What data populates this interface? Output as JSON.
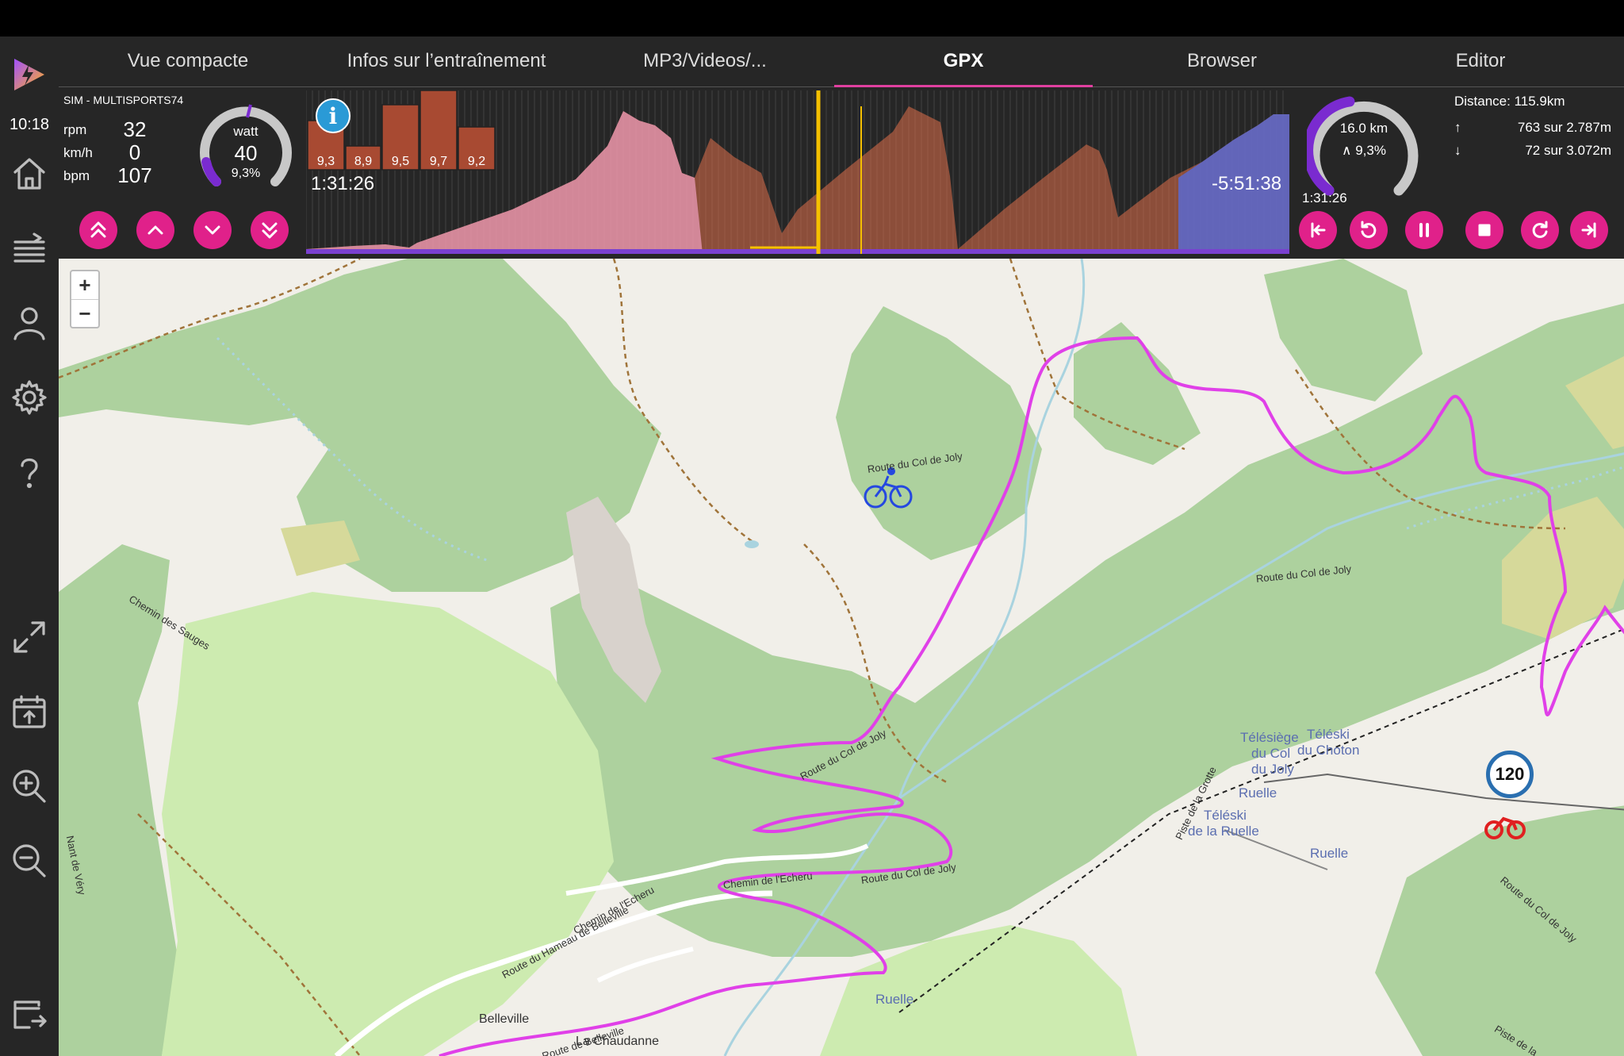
{
  "app": {
    "clock": "10:18"
  },
  "tabs": [
    {
      "label": "Vue compacte"
    },
    {
      "label": "Infos sur l’entraînement"
    },
    {
      "label": "MP3/Videos/..."
    },
    {
      "label": "GPX"
    },
    {
      "label": "Browser"
    },
    {
      "label": "Editor"
    }
  ],
  "active_tab": "GPX",
  "device": {
    "name": "SIM - MULTISPORTS74"
  },
  "metrics": {
    "rpm": {
      "unit": "rpm",
      "value": "32"
    },
    "kmh": {
      "unit": "km/h",
      "value": "0"
    },
    "bpm": {
      "unit": "bpm",
      "value": "107"
    }
  },
  "power_gauge": {
    "unit": "watt",
    "value": "40",
    "grade": "9,3%"
  },
  "profile": {
    "elapsed": "1:31:26",
    "remaining": "-5:51:38",
    "info_icon": "info-icon",
    "segment_grades": [
      "9,3",
      "8,9",
      "9,5",
      "9,7",
      "9,2"
    ]
  },
  "distance_ring": {
    "distance": "16.0 km",
    "grade": "∧ 9,3%",
    "time": "1:31:26"
  },
  "stats": {
    "total_distance": "Distance: 115.9km",
    "ascent": "763 sur 2.787m",
    "descent": "72 sur 3.072m"
  },
  "map": {
    "zoom_in": "+",
    "zoom_out": "−",
    "labels": {
      "telesiege": "Télésiège",
      "du_col": "du Col",
      "du_joly": "du Joly",
      "teleski1": "Téléski",
      "du_choton": "du Choton",
      "ruelle1": "Ruelle",
      "teleski2": "Téléski",
      "de_la_ruelle": "de la Ruelle",
      "ruelle2": "Ruelle",
      "ruelle3": "Ruelle",
      "belleville": "Belleville",
      "la_chaudanne": "La Chaudanne"
    },
    "roads": {
      "col_joly_1": "Route du Col de Joly",
      "col_joly_2": "Route du Col de Joly",
      "col_joly_3": "Route du Col de Joly",
      "col_joly_4": "Route du Col de Joly",
      "col_joly_5": "Route du Col de Joly",
      "echeru_1": "Chemin de l'Echeru",
      "echeru_2": "Chemin de l'Echeru",
      "hameau": "Route du Hameau de Belleville",
      "belleville_road": "Route de Belleville",
      "sauges": "Chemin des Sauges",
      "grotte": "Piste de la Grotte",
      "nant": "Nant de Véry",
      "piste_la": "Piste de la"
    },
    "speed_limit": "120"
  },
  "colors": {
    "accent": "#e0218a",
    "route": "#e040e8",
    "gauge_purple": "#7a2bd0",
    "sidebar_icon": "#bdbdbd"
  }
}
